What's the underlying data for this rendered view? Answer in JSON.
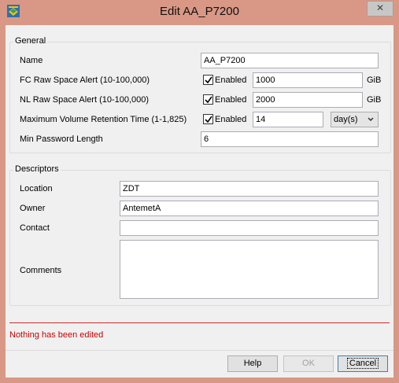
{
  "window": {
    "title": "Edit AA_P7200",
    "close_symbol": "✕",
    "close_label": "Close"
  },
  "general": {
    "title": "General",
    "name_label": "Name",
    "name_value": "AA_P7200",
    "fc_label": "FC Raw Space Alert  (10-100,000)",
    "fc_enabled_label": "Enabled",
    "fc_enabled": true,
    "fc_value": "1000",
    "fc_unit": "GiB",
    "nl_label": "NL Raw Space Alert  (10-100,000)",
    "nl_enabled_label": "Enabled",
    "nl_enabled": true,
    "nl_value": "2000",
    "nl_unit": "GiB",
    "retention_label": "Maximum Volume Retention Time  (1-1,825)",
    "retention_enabled_label": "Enabled",
    "retention_enabled": true,
    "retention_value": "14",
    "retention_unit": "day(s)",
    "password_label": "Min Password Length",
    "password_value": "6"
  },
  "descriptors": {
    "title": "Descriptors",
    "location_label": "Location",
    "location_value": "ZDT",
    "owner_label": "Owner",
    "owner_value": "AntemetA",
    "contact_label": "Contact",
    "contact_value": "",
    "comments_label": "Comments",
    "comments_value": ""
  },
  "status": {
    "message": "Nothing has been edited",
    "color": "#cc0000"
  },
  "buttons": {
    "help": "Help",
    "ok": "OK",
    "cancel": "Cancel"
  },
  "colors": {
    "window_frame": "#d99886",
    "accent": "#3c7fb1"
  },
  "icons": {
    "app": "app-logo-icon",
    "close": "close-icon",
    "check": "check-icon",
    "dropdown": "chevron-down-icon"
  }
}
